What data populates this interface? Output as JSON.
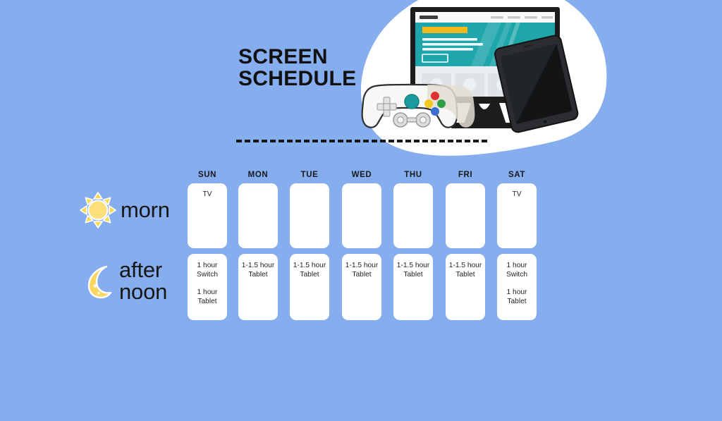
{
  "page": {
    "background_color": "#86aeef",
    "card_color": "#ffffff",
    "text_color": "#242424",
    "accent_teal": "#1aa9ae",
    "accent_orange": "#f5b81c"
  },
  "title": {
    "line1": "SCREEN",
    "line2": "SCHEDULE"
  },
  "illustration": {
    "blob": "white-blob-shape",
    "monitor": "desktop-monitor-icon",
    "gamepad": "game-controller-icon",
    "tablet": "tablet-device-icon",
    "screen_content": {
      "logo_bar": "nav-logo",
      "nav_items": 4,
      "headline_bar": "orange-headline",
      "text_lines": 3,
      "cta_button": "outline-button",
      "cards": 4
    }
  },
  "divider": {
    "style": "dashed"
  },
  "schedule": {
    "rows": [
      {
        "key": "morning",
        "label": "morn",
        "icon": "sun-icon"
      },
      {
        "key": "afternoon",
        "label": "after\nnoon",
        "icon": "crescent-moon-icon"
      }
    ],
    "days": [
      {
        "abbr": "SUN",
        "morning": "TV",
        "afternoon": "1 hour\nSwitch\n\n1 hour\nTablet"
      },
      {
        "abbr": "MON",
        "morning": "",
        "afternoon": "1-1.5 hour\nTablet"
      },
      {
        "abbr": "TUE",
        "morning": "",
        "afternoon": "1-1.5 hour\nTablet"
      },
      {
        "abbr": "WED",
        "morning": "",
        "afternoon": "1-1.5 hour\nTablet"
      },
      {
        "abbr": "THU",
        "morning": "",
        "afternoon": "1-1.5 hour\nTablet"
      },
      {
        "abbr": "FRI",
        "morning": "",
        "afternoon": "1-1.5 hour\nTablet"
      },
      {
        "abbr": "SAT",
        "morning": "TV",
        "afternoon": "1 hour\nSwitch\n\n1 hour\nTablet"
      }
    ]
  }
}
